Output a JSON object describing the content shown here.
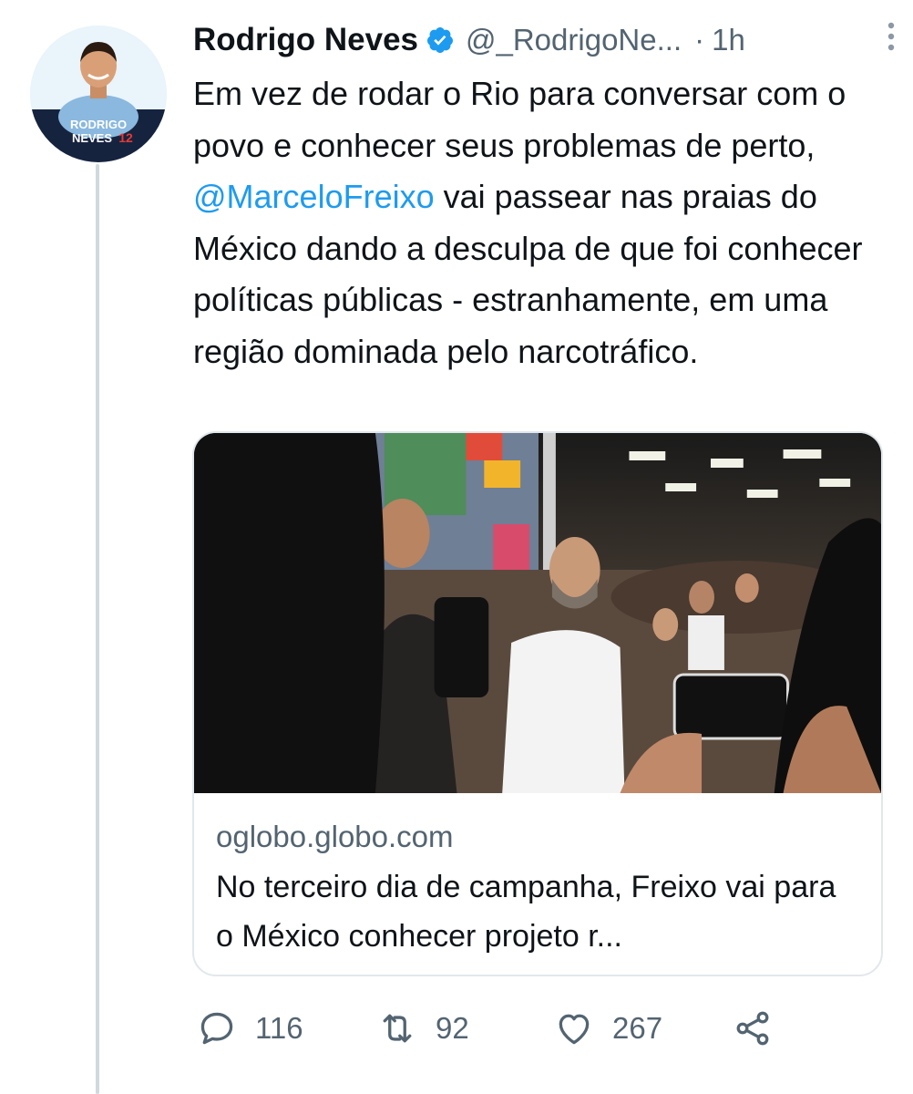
{
  "tweet": {
    "author": {
      "name": "Rodrigo Neves",
      "handle": "@_RodrigoNe...",
      "verified_icon": "verified-badge-icon",
      "avatar_text_line1": "RODRIGO",
      "avatar_text_line2": "NEVES",
      "avatar_number": "12"
    },
    "separator": "·",
    "time": "1h",
    "text_before": "Em vez de rodar o Rio para conversar com o povo e conhecer seus problemas de perto, ",
    "mention": "@MarceloFreixo",
    "text_after": " vai passear nas praias do México dando a desculpa de que foi conhecer políticas públicas - estranhamente, em uma região dominada pelo narcotráfico.",
    "link_card": {
      "domain": "oglobo.globo.com",
      "title": "No terceiro dia de campanha, Freixo vai para o México conhecer projeto r..."
    },
    "actions": {
      "replies": "116",
      "retweets": "92",
      "likes": "267"
    }
  },
  "colors": {
    "accent": "#1d9bf0",
    "text": "#0f1419",
    "secondary": "#536471",
    "thread_line": "#cfd9de"
  }
}
